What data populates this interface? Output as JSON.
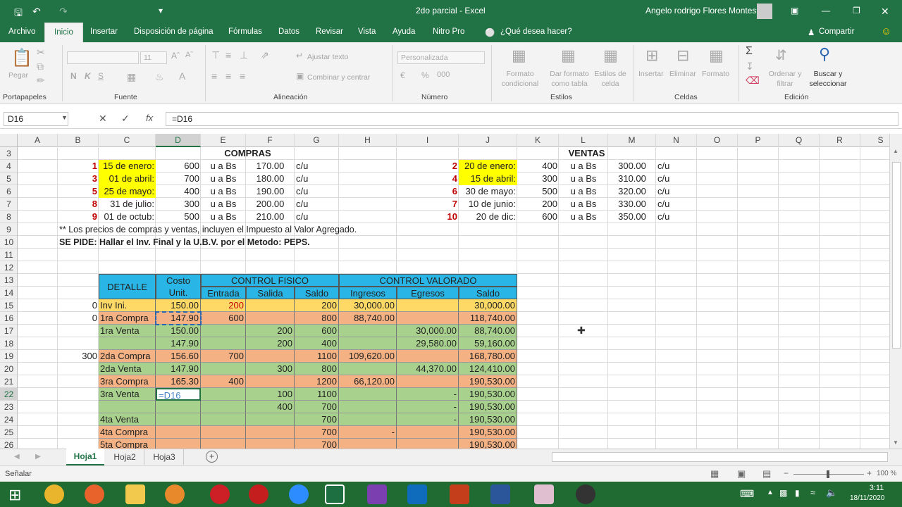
{
  "title": {
    "doc": "2do parcial  -  Excel",
    "user": "Angelo rodrigo Flores Montes"
  },
  "menu": [
    "Archivo",
    "Inicio",
    "Insertar",
    "Disposición de página",
    "Fórmulas",
    "Datos",
    "Revisar",
    "Vista",
    "Ayuda",
    "Nitro Pro",
    "¿Qué desea hacer?",
    "Compartir"
  ],
  "ribbon": {
    "paste": "Pegar",
    "font_size": "11",
    "ajustar": "Ajustar texto",
    "combinar": "Combinar y centrar",
    "number_format": "Personalizada",
    "formato_cond": "Formato condicional",
    "formato_tabla": "Dar formato como tabla",
    "estilos_celda": "Estilos de celda",
    "insertar": "Insertar",
    "eliminar": "Eliminar",
    "formato": "Formato",
    "ordenar": "Ordenar y filtrar",
    "buscar": "Buscar y seleccionar",
    "groups": [
      "Portapapeles",
      "Fuente",
      "Alineación",
      "Número",
      "Estilos",
      "Celdas",
      "Edición"
    ]
  },
  "formula": {
    "namebox": "D16",
    "value": "=D16"
  },
  "columns": [
    "A",
    "B",
    "C",
    "D",
    "E",
    "F",
    "G",
    "H",
    "I",
    "J",
    "K",
    "L",
    "M",
    "N",
    "O",
    "P",
    "Q",
    "R",
    "S"
  ],
  "rows": [
    "3",
    "4",
    "5",
    "6",
    "7",
    "8",
    "9",
    "10",
    "11",
    "12",
    "13",
    "14",
    "15",
    "16",
    "17",
    "18",
    "19",
    "20",
    "21",
    "22",
    "23",
    "24",
    "25",
    "26"
  ],
  "compras": {
    "title": "COMPRAS",
    "rows": [
      {
        "n": "1",
        "fecha": "15 de enero:",
        "q": "600",
        "u": "u a Bs",
        "p": "170.00",
        "cu": "c/u"
      },
      {
        "n": "3",
        "fecha": "01 de abril:",
        "q": "700",
        "u": "u a Bs",
        "p": "180.00",
        "cu": "c/u"
      },
      {
        "n": "5",
        "fecha": "25 de mayo:",
        "q": "400",
        "u": "u a Bs",
        "p": "190.00",
        "cu": "c/u"
      },
      {
        "n": "8",
        "fecha": "31 de julio:",
        "q": "300",
        "u": "u a Bs",
        "p": "200.00",
        "cu": "c/u"
      },
      {
        "n": "9",
        "fecha": "01 de octub:",
        "q": "500",
        "u": "u a Bs",
        "p": "210.00",
        "cu": "c/u"
      }
    ]
  },
  "ventas": {
    "title": "VENTAS",
    "rows": [
      {
        "n": "2",
        "fecha": "20 de enero:",
        "q": "400",
        "u": "u a Bs",
        "p": "300.00",
        "cu": "c/u"
      },
      {
        "n": "4",
        "fecha": "15 de abril:",
        "q": "300",
        "u": "u a Bs",
        "p": "310.00",
        "cu": "c/u"
      },
      {
        "n": "6",
        "fecha": "30 de mayo:",
        "q": "500",
        "u": "u a Bs",
        "p": "320.00",
        "cu": "c/u"
      },
      {
        "n": "7",
        "fecha": "10 de junio:",
        "q": "200",
        "u": "u a Bs",
        "p": "330.00",
        "cu": "c/u"
      },
      {
        "n": "10",
        "fecha": "20 de dic:",
        "q": "600",
        "u": "u a Bs",
        "p": "350.00",
        "cu": "c/u"
      }
    ]
  },
  "note": "** Los precios de compras y ventas, incluyen el Impuesto al Valor Agregado.",
  "se_pide": "SE PIDE: Hallar el Inv. Final y la U.B.V. por el Metodo: PEPS.",
  "table": {
    "headers": {
      "detalle": "DETALLE",
      "costo1": "Costo",
      "costo2": "Unit.",
      "fisico": "CONTROL FISICO",
      "valorado": "CONTROL VALORADO",
      "entrada": "Entrada",
      "salida": "Salida",
      "saldo": "Saldo",
      "ingresos": "Ingresos",
      "egresos": "Egresos",
      "saldo2": "Saldo"
    },
    "rows": [
      {
        "b": "0",
        "det": "Inv Ini.",
        "cu": "150.00",
        "ent": "200",
        "sal": "",
        "sdo": "200",
        "ing": "30,000.00",
        "egr": "",
        "sv": "30,000.00",
        "bg": "#ffd966"
      },
      {
        "b": "0",
        "det": "1ra Compra",
        "cu": "147.90",
        "ent": "600",
        "sal": "",
        "sdo": "800",
        "ing": "88,740.00",
        "egr": "",
        "sv": "118,740.00",
        "bg": "#f4b183"
      },
      {
        "b": "",
        "det": "1ra Venta",
        "cu": "150.00",
        "ent": "",
        "sal": "200",
        "sdo": "600",
        "ing": "",
        "egr": "30,000.00",
        "sv": "88,740.00",
        "bg": "#a9d18e"
      },
      {
        "b": "",
        "det": "",
        "cu": "147.90",
        "ent": "",
        "sal": "200",
        "sdo": "400",
        "ing": "",
        "egr": "29,580.00",
        "sv": "59,160.00",
        "bg": "#a9d18e"
      },
      {
        "b": "300",
        "det": "2da Compra",
        "cu": "156.60",
        "ent": "700",
        "sal": "",
        "sdo": "1100",
        "ing": "109,620.00",
        "egr": "",
        "sv": "168,780.00",
        "bg": "#f4b183"
      },
      {
        "b": "",
        "det": "2da Venta",
        "cu": "147.90",
        "ent": "",
        "sal": "300",
        "sdo": "800",
        "ing": "",
        "egr": "44,370.00",
        "sv": "124,410.00",
        "bg": "#a9d18e"
      },
      {
        "b": "",
        "det": "3ra Compra",
        "cu": "165.30",
        "ent": "400",
        "sal": "",
        "sdo": "1200",
        "ing": "66,120.00",
        "egr": "",
        "sv": "190,530.00",
        "bg": "#f4b183"
      },
      {
        "b": "",
        "det": "3ra Venta",
        "cu": "=D16",
        "ent": "",
        "sal": "100",
        "sdo": "1100",
        "ing": "",
        "egr": "-",
        "sv": "190,530.00",
        "bg": "#a9d18e"
      },
      {
        "b": "",
        "det": "",
        "cu": "",
        "ent": "",
        "sal": "400",
        "sdo": "700",
        "ing": "",
        "egr": "-",
        "sv": "190,530.00",
        "bg": "#a9d18e"
      },
      {
        "b": "",
        "det": "4ta Venta",
        "cu": "",
        "ent": "",
        "sal": "",
        "sdo": "700",
        "ing": "",
        "egr": "-",
        "sv": "190,530.00",
        "bg": "#a9d18e"
      },
      {
        "b": "",
        "det": "4ta Compra",
        "cu": "",
        "ent": "",
        "sal": "",
        "sdo": "700",
        "ing": "-",
        "egr": "",
        "sv": "190,530.00",
        "bg": "#f4b183"
      },
      {
        "b": "",
        "det": "5ta Compra",
        "cu": "",
        "ent": "",
        "sal": "",
        "sdo": "700",
        "ing": "",
        "egr": "",
        "sv": "190,530.00",
        "bg": "#f4b183"
      }
    ]
  },
  "sheets": [
    "Hoja1",
    "Hoja2",
    "Hoja3"
  ],
  "status": {
    "mode": "Señalar",
    "zoom": "100 %"
  },
  "clock": {
    "time": "3:11",
    "date": "18/11/2020"
  }
}
